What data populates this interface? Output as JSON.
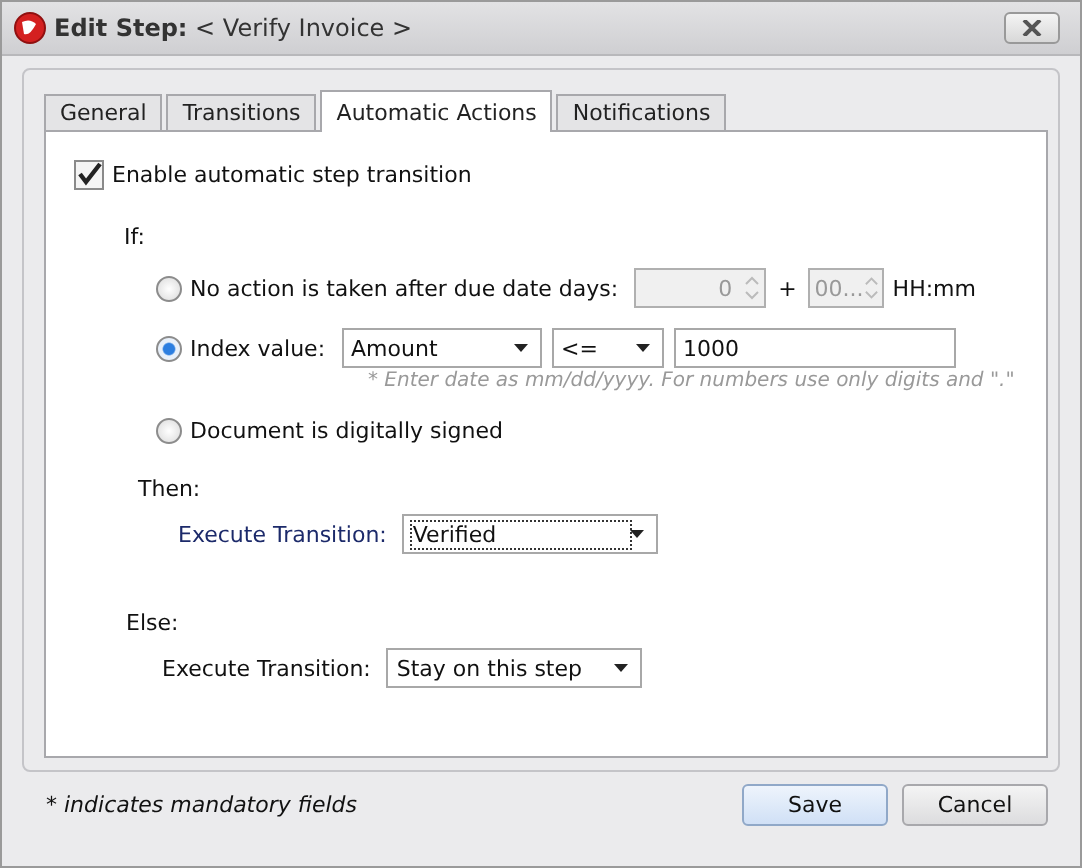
{
  "window": {
    "title_prefix": "Edit Step:",
    "title": "< Verify Invoice >"
  },
  "tabs": [
    {
      "label": "General",
      "selected": false
    },
    {
      "label": "Transitions",
      "selected": false
    },
    {
      "label": "Automatic Actions",
      "selected": true
    },
    {
      "label": "Notifications",
      "selected": false
    }
  ],
  "enable_transition": {
    "label": "Enable automatic step transition",
    "checked": true
  },
  "condition": {
    "label": "If:",
    "options": [
      {
        "kind": "due_date",
        "label": "No action is taken after due date days:",
        "selected": false,
        "days": "0",
        "plus": "+",
        "time": "00...",
        "time_unit": "HH:mm"
      },
      {
        "kind": "index",
        "label": "Index value:",
        "selected": true,
        "field": "Amount",
        "operator": "<=",
        "value": "1000",
        "hint": "* Enter date as mm/dd/yyyy. For numbers use only digits and \".\""
      },
      {
        "kind": "plain",
        "label": "Document is digitally signed",
        "selected": false
      }
    ]
  },
  "then": {
    "label": "Then:",
    "transition_label": "Execute Transition:",
    "transition": "Verified",
    "focused": true
  },
  "else": {
    "label": "Else:",
    "transition_label": "Execute Transition:",
    "transition": "Stay on this step",
    "focused": false
  },
  "footer_note": "* indicates mandatory fields",
  "buttons": [
    {
      "label": "Save",
      "default": true
    },
    {
      "label": "Cancel",
      "default": false
    }
  ]
}
